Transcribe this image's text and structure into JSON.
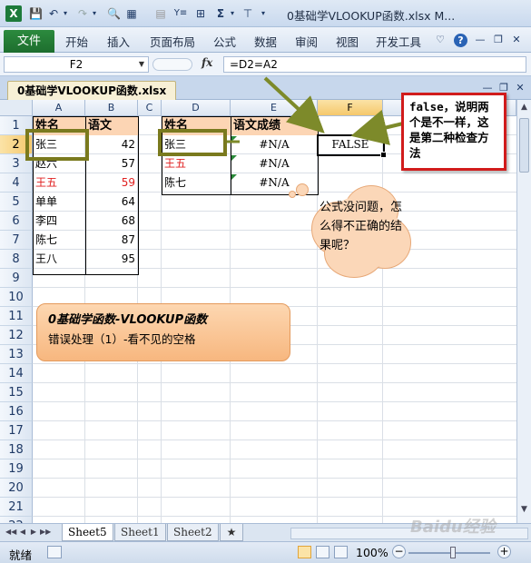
{
  "window": {
    "title": "0基础学VLOOKUP函数.xlsx M...",
    "app_icon": "X",
    "quick_access": [
      "save-icon",
      "undo-icon",
      "redo-icon",
      "print-preview-icon",
      "border-icon",
      "form-icon",
      "filter-icon",
      "table-icon",
      "sum-icon",
      "dropdown-icon",
      "fill-icon",
      "dropdown-icon"
    ]
  },
  "ribbon": {
    "file": "文件",
    "tabs": [
      "开始",
      "插入",
      "页面布局",
      "公式",
      "数据",
      "审阅",
      "视图",
      "开发工具"
    ]
  },
  "formula_bar": {
    "name_box": "F2",
    "fx": "fx",
    "formula": "=D2=A2"
  },
  "workbook_tab": "0基础学VLOOKUP函数.xlsx",
  "columns": [
    "A",
    "B",
    "C",
    "D",
    "E",
    "F"
  ],
  "rows": [
    "1",
    "2",
    "3",
    "4",
    "5",
    "6",
    "7",
    "8",
    "9",
    "10",
    "11",
    "12",
    "13",
    "14",
    "15",
    "16",
    "17",
    "18",
    "19",
    "20",
    "21",
    "22"
  ],
  "table1": {
    "headers": [
      "姓名",
      "语文"
    ],
    "rows": [
      {
        "name": "张三",
        "score": "42",
        "red": false
      },
      {
        "name": "赵六",
        "score": "57",
        "red": false
      },
      {
        "name": "王五",
        "score": "59",
        "red": true
      },
      {
        "name": "单单",
        "score": "64",
        "red": false
      },
      {
        "name": "李四",
        "score": "68",
        "red": false
      },
      {
        "name": "陈七",
        "score": "87",
        "red": false
      },
      {
        "name": "王八",
        "score": "95",
        "red": false
      }
    ]
  },
  "table2": {
    "headers": [
      "姓名",
      "语文成绩"
    ],
    "rows": [
      {
        "name": "张三",
        "value": "#N/A",
        "red": false
      },
      {
        "name": "王五",
        "value": "#N/A",
        "red": true
      },
      {
        "name": "陈七",
        "value": "#N/A",
        "red": false
      }
    ]
  },
  "f2_value": "FALSE",
  "note_text": "false，说明两个是不一样，这是第二种检查方法",
  "cloud_text": "公式没问题，怎么得不正确的结果呢？",
  "banner": {
    "line1": "0基础学函数-VLOOKUP函数",
    "line2": "错误处理（1）-看不见的空格"
  },
  "sheet_tabs": [
    "Sheet5",
    "Sheet1",
    "Sheet2"
  ],
  "status": {
    "ready": "就绪",
    "zoom": "100%"
  },
  "watermark": "Baidu经验",
  "colors": {
    "accent_green": "#7a7a1e",
    "note_border": "#d11c1c",
    "header_fill": "#fcd5b4",
    "file_tab": "#1d6e2e"
  }
}
